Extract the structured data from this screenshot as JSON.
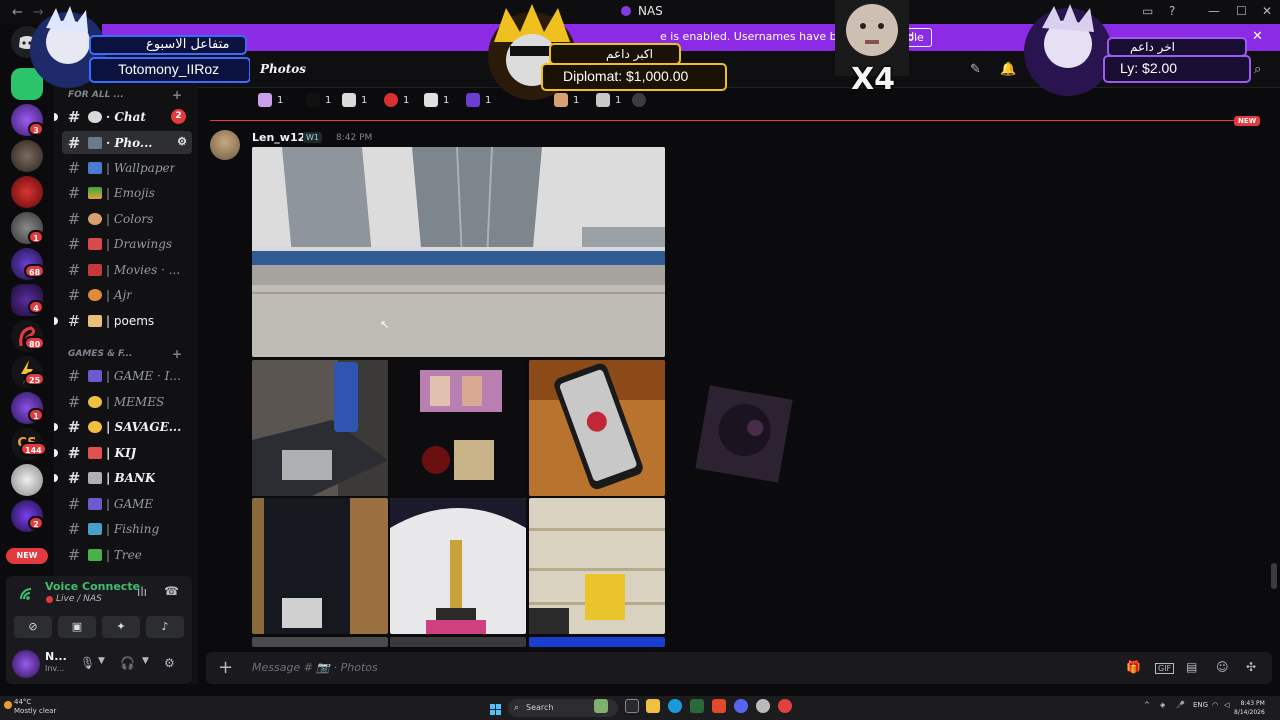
{
  "window": {
    "title": "NAS",
    "back_icon": "←",
    "forward_icon": "→"
  },
  "banner": {
    "text": "e is enabled. Usernames have been truncated.",
    "button": "Disable"
  },
  "server_badges": [
    "3",
    "1",
    "68",
    "4",
    "80",
    "25",
    "1",
    "144",
    "2"
  ],
  "new_pill": "NEW",
  "sidebar": {
    "category1": "FOR ALL ...",
    "category2": "GAMES & F...",
    "channels": [
      {
        "name": "· Chat",
        "badge": "2"
      },
      {
        "name": "· Pho...",
        "badge": ""
      },
      {
        "name": "| Wallpaper",
        "badge": ""
      },
      {
        "name": "| Emojis",
        "badge": ""
      },
      {
        "name": "| Colors",
        "badge": ""
      },
      {
        "name": "| Drawings",
        "badge": ""
      },
      {
        "name": "| Movies · ...",
        "badge": ""
      },
      {
        "name": "| Ajr",
        "badge": ""
      },
      {
        "name": "| poems",
        "badge": ""
      },
      {
        "name": "| GAME · I...",
        "badge": ""
      },
      {
        "name": "| MEMES",
        "badge": ""
      },
      {
        "name": "| SAVAGE...",
        "badge": ""
      },
      {
        "name": "| KIJ",
        "badge": ""
      },
      {
        "name": "| BANK",
        "badge": ""
      },
      {
        "name": "| GAME",
        "badge": ""
      },
      {
        "name": "| Fishing",
        "badge": ""
      },
      {
        "name": "| Tree",
        "badge": ""
      }
    ]
  },
  "voice": {
    "status": "Voice Connecte",
    "sub": "Live / NAS"
  },
  "user": {
    "name": "N...",
    "status": "Inv..."
  },
  "chat": {
    "channel_title": "Photos",
    "reaction_counts": [
      "1",
      "1",
      "1",
      "1",
      "1",
      "1",
      "1",
      "1"
    ],
    "new_tag": "NEW",
    "message": {
      "author": "Len_w12",
      "role": "W1",
      "time": "8:42 PM"
    },
    "composer_placeholder": "Message # 📷 · Photos"
  },
  "overlays": {
    "weekly_title": "متفاعل الاسبوع",
    "weekly_name": "Totomony_IIRoz",
    "top_supporter_title": "اكبر داعم",
    "top_supporter_value": "Diplomat: $1,000.00",
    "last_supporter_title": "اخر داعم",
    "last_supporter_value": "Ly: $2.00",
    "multiplier": "X4"
  },
  "taskbar": {
    "weather_temp": "44°C",
    "weather_desc": "Mostly clear",
    "search": "Search",
    "lang": "ENG",
    "time": "8:43 PM",
    "date": "8/14/2026"
  },
  "colors": {
    "banner": "#8b2be6",
    "badge": "#e23a3f",
    "voice_green": "#3fbf70",
    "background": "#0b0b0d"
  }
}
